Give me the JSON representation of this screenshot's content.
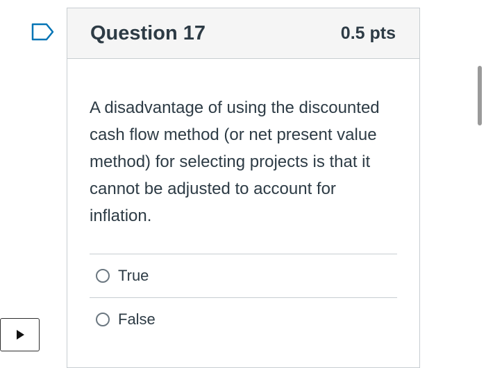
{
  "question": {
    "title": "Question 17",
    "points": "0.5 pts",
    "text": "A disadvantage of using the discounted cash flow method (or net present value method) for selecting projects is that it cannot be adjusted to account for inflation.",
    "answers": [
      {
        "label": "True",
        "selected": false
      },
      {
        "label": "False",
        "selected": false
      }
    ]
  },
  "icons": {
    "flag": "flag-icon",
    "play": "play-icon"
  },
  "colors": {
    "accent": "#0374b5",
    "text": "#2d3b45",
    "header_bg": "#f5f5f5",
    "border": "#c7cdd1"
  }
}
